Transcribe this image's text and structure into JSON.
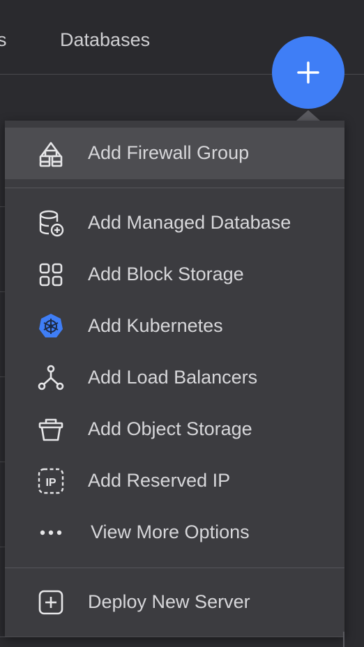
{
  "nav": {
    "partial_tab": "s",
    "databases_tab": "Databases"
  },
  "fab": {
    "label": "+",
    "icon": "plus-icon",
    "color": "#3f7ef6"
  },
  "menu": {
    "items": [
      {
        "label": "Add Firewall Group",
        "icon": "firewall-icon",
        "highlighted": true
      },
      {
        "label": "Add Managed Database",
        "icon": "database-add-icon"
      },
      {
        "label": "Add Block Storage",
        "icon": "block-storage-icon"
      },
      {
        "label": "Add Kubernetes",
        "icon": "kubernetes-icon",
        "icon_color": "#3f7ef6"
      },
      {
        "label": "Add Load Balancers",
        "icon": "load-balancer-icon"
      },
      {
        "label": "Add Object Storage",
        "icon": "object-storage-icon"
      },
      {
        "label": "Add Reserved IP",
        "icon": "reserved-ip-icon",
        "icon_text": "IP"
      },
      {
        "label": "View More Options",
        "icon": "more-dots-icon"
      },
      {
        "label": "Deploy New Server",
        "icon": "plus-square-icon"
      }
    ]
  }
}
